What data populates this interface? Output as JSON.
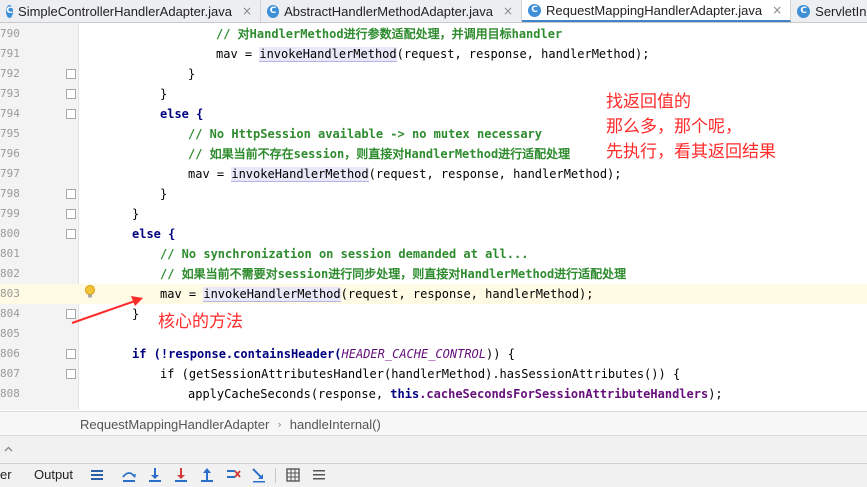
{
  "tabs": [
    {
      "label": "SimpleControllerHandlerAdapter.java",
      "active": false
    },
    {
      "label": "AbstractHandlerMethodAdapter.java",
      "active": false
    },
    {
      "label": "RequestMappingHandlerAdapter.java",
      "active": true
    },
    {
      "label": "ServletIn",
      "active": false
    }
  ],
  "tab_icon_letter": "C",
  "tab_close": "×",
  "line_numbers": [
    "790",
    "791",
    "792",
    "793",
    "794",
    "795",
    "796",
    "797",
    "798",
    "799",
    "800",
    "801",
    "802",
    "803",
    "804",
    "805",
    "806",
    "807",
    "808"
  ],
  "code": {
    "l790": "// 对HandlerMethod进行参数适配处理，并调用目标handler",
    "l791_pre": "mav = ",
    "l791_call": "invokeHandlerMethod",
    "l791_post": "(request, response, handlerMethod);",
    "l792": "}",
    "l793": "}",
    "l794": "else {",
    "l795": "// No HttpSession available -> no mutex necessary",
    "l796": "// 如果当前不存在session，则直接对HandlerMethod进行适配处理",
    "l797_pre": "mav = ",
    "l797_call": "invokeHandlerMethod",
    "l797_post": "(request, response, handlerMethod);",
    "l798": "}",
    "l799": "}",
    "l800": "else {",
    "l801": "// No synchronization on session demanded at all...",
    "l802": "// 如果当前不需要对session进行同步处理，则直接对HandlerMethod进行适配处理",
    "l803_pre": "mav = ",
    "l803_call": "invokeHandlerMethod",
    "l803_post": "(request, response, handlerMethod);",
    "l804": "}",
    "l806_pre": "if (!response.containsHeader(",
    "l806_const": "HEADER_CACHE_CONTROL",
    "l806_post": ")) {",
    "l807": "if (getSessionAttributesHandler(handlerMethod).hasSessionAttributes()) {",
    "l808_pre": "applyCacheSeconds(response, ",
    "l808_this": "this",
    "l808_field": ".cacheSecondsForSessionAttributeHandlers",
    "l808_post": ");"
  },
  "annotations": {
    "note_top": [
      "找返回值的",
      "那么多，那个呢，",
      "先执行，看其返回结果"
    ],
    "note_core": "核心的方法"
  },
  "breadcrumb": {
    "class": "RequestMappingHandlerAdapter",
    "method": "handleInternal()",
    "separator": "›"
  },
  "toolbar": {
    "left_tab": "er",
    "output_tab": "Output"
  },
  "colors": {
    "keyword": "#000080",
    "comment_green": "#2e8b2e",
    "annotation_red": "#ff2a2a",
    "current_line": "#fffae3"
  }
}
